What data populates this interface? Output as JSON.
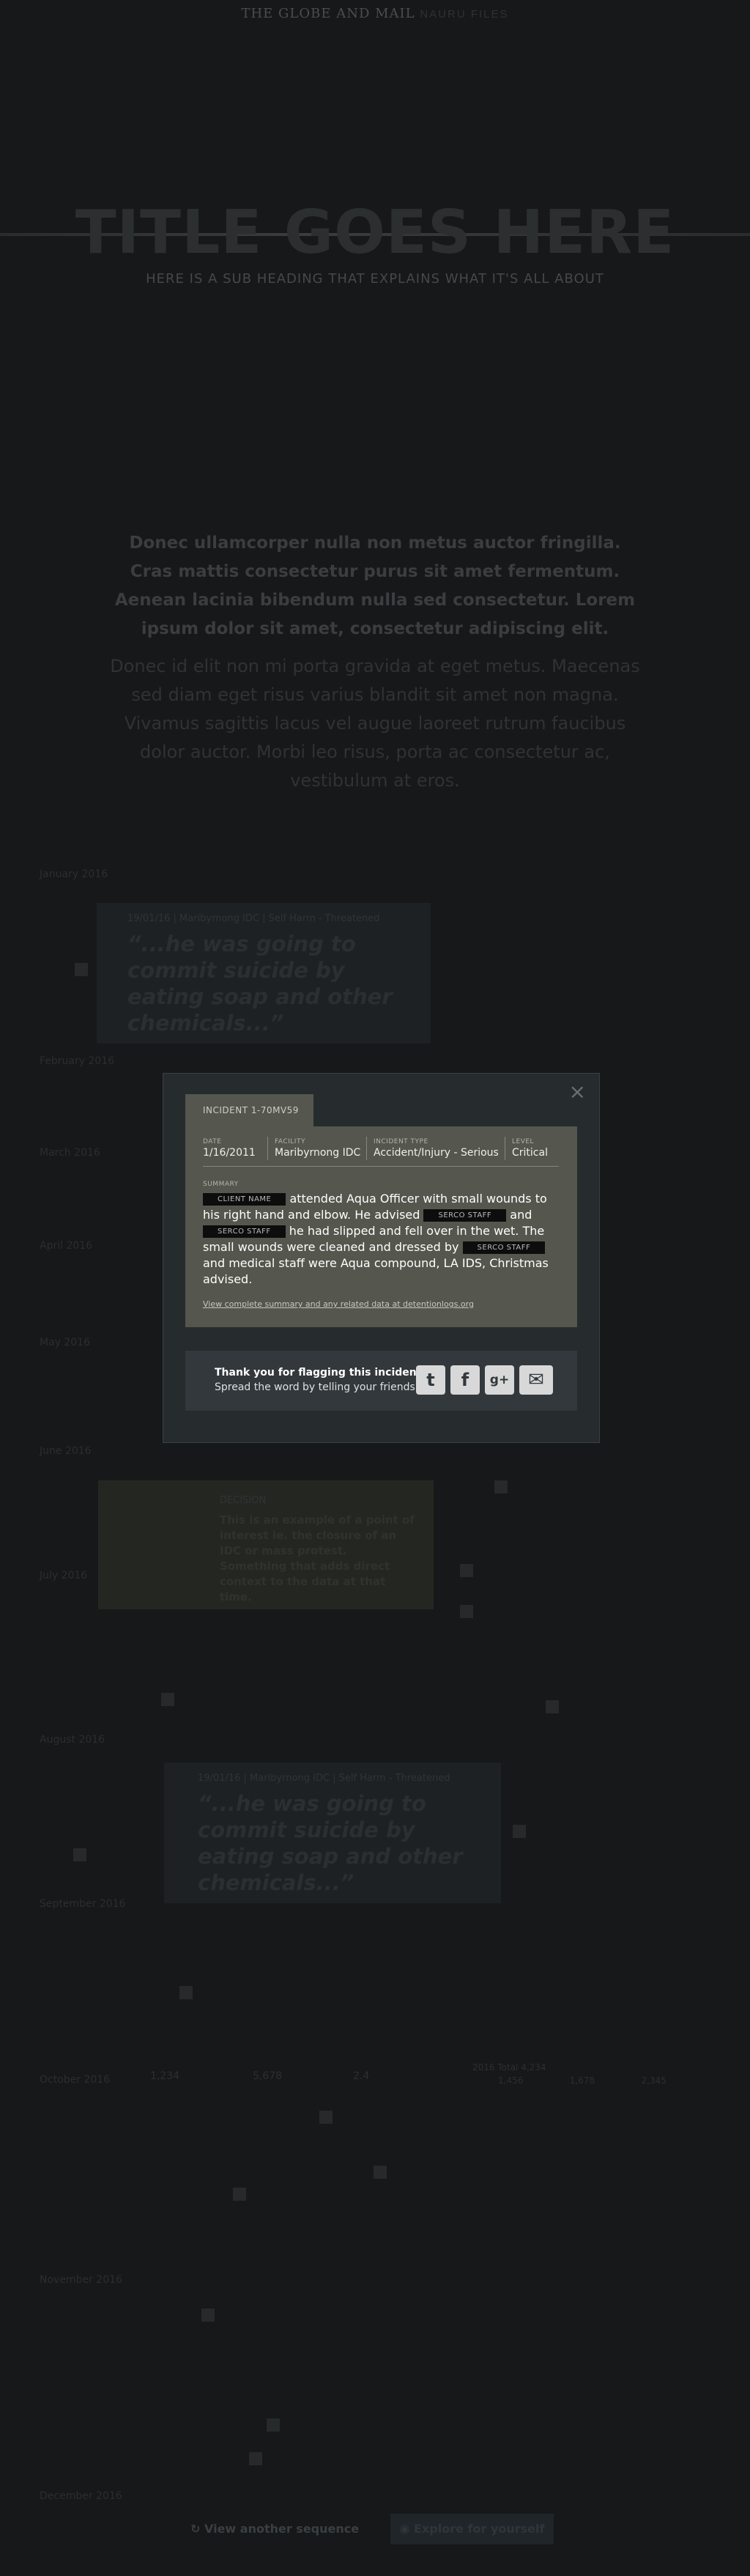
{
  "header": {
    "masthead": "THE GLOBE AND MAIL",
    "masthead_section": "NAURU FILES",
    "title": "TITLE GOES HERE",
    "subheading": "HERE IS A SUB HEADING THAT EXPLAINS WHAT IT'S ALL ABOUT"
  },
  "intro": {
    "bold": "Donec ullamcorper nulla non metus auctor fringilla. Cras mattis consectetur purus sit amet fermentum. Aenean lacinia bibendum nulla sed consectetur. Lorem ipsum dolor sit amet, consectetur adipiscing elit.",
    "body": "Donec id elit non mi porta gravida at eget metus. Maecenas sed diam eget risus varius blandit sit amet non magna. Vivamus sagittis lacus vel augue laoreet rutrum faucibus dolor auctor. Morbi leo risus, porta ac consectetur ac, vestibulum at eros."
  },
  "timeline": {
    "months": [
      "January 2016",
      "February 2016",
      "March 2016",
      "April 2016",
      "May 2016",
      "June 2016",
      "July 2016",
      "August 2016",
      "September 2016",
      "October 2016",
      "November 2016",
      "December 2016"
    ],
    "card1": {
      "meta": "19/01/16 | Maribyrnong IDC | Self Harm - Threatened",
      "quote": "“...he was going to commit suicide by eating soap and other chemicals...”"
    },
    "card2": {
      "meta": "DECISION",
      "text": "This is an example of a point of interest ie. the closure of an IDC or mass protest. Something that adds direct context to the data at that time."
    },
    "card3": {
      "meta": "19/01/16 | Maribyrnong IDC | Self Harm - Threatened",
      "quote": "“...he was going to commit suicide by eating soap and other chemicals...”"
    }
  },
  "modal": {
    "close_glyph": "×",
    "tab_label": "INCIDENT 1-70MV59",
    "fields": [
      {
        "label": "DATE",
        "value": "1/16/2011"
      },
      {
        "label": "FACILITY",
        "value": "Maribyrnong IDC"
      },
      {
        "label": "INCIDENT TYPE",
        "value": "Accident/Injury - Serious"
      },
      {
        "label": "LEVEL",
        "value": "Critical"
      }
    ],
    "summary_label": "SUMMARY",
    "summary": {
      "redact_client": "CLIENT NAME",
      "s1": " attended Aqua Officer with small wounds to his right hand and elbow. He advised ",
      "redact_staff1": "SERCO STAFF",
      "s2": " and ",
      "redact_staff2": "SERCO STAFF",
      "s3": " he had slipped and fell over in the wet. The small wounds were cleaned and dressed by ",
      "redact_staff3": "SERCO STAFF",
      "s4": " and medical staff were Aqua compound, LA IDS, Christmas advised."
    },
    "link_text": "View complete summary and any related data at detentionlogs.org",
    "share": {
      "line1": "Thank you for flagging this incident.",
      "line2": "Spread the word by telling your friends:",
      "icons": [
        "twitter-icon",
        "facebook-icon",
        "google-plus-icon",
        "email-icon"
      ]
    }
  },
  "stats": {
    "v1": "1,234",
    "v2": "5,678",
    "v3": "2.4",
    "extra_label": "2016 Total",
    "v4": "4,234",
    "row": [
      "1,456",
      "1,678",
      "2,345"
    ]
  },
  "footer": {
    "view_label": "View another sequence",
    "explore_label": "Explore for yourself"
  },
  "colors": {
    "background": "#161819",
    "panel": "#55564d",
    "modal": "#262b2e",
    "redaction": "#0d0d0d"
  }
}
